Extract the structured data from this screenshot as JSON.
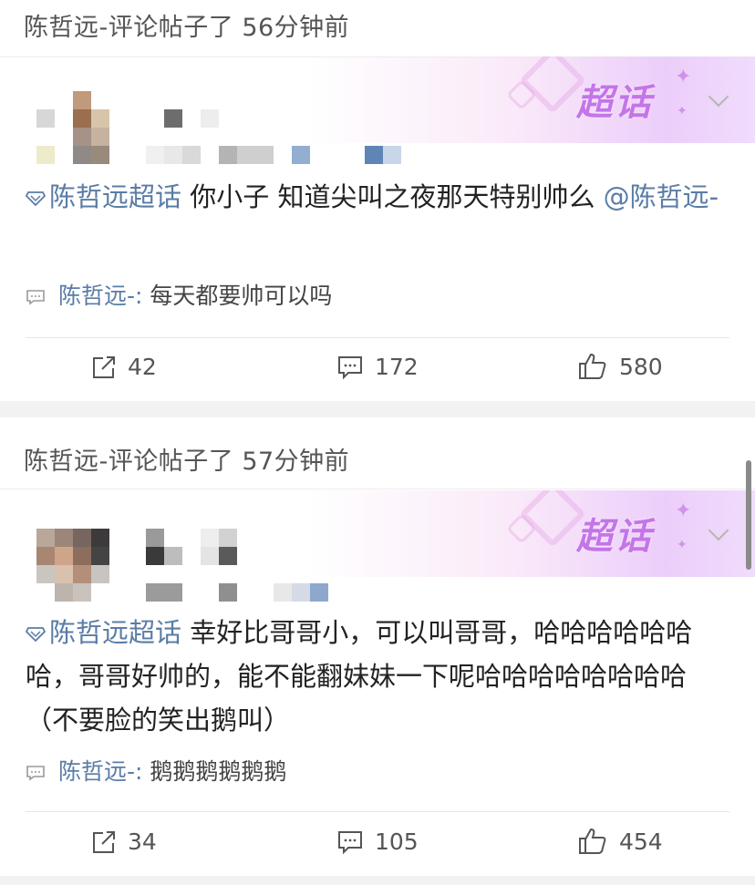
{
  "posts": [
    {
      "header": "陈哲远-评论帖子了 56分钟前",
      "badge": "超话",
      "topic": "陈哲远超话",
      "body": " 你小子 知道尖叫之夜那天特别帅么 ",
      "mention": "@陈哲远-",
      "comment_user": "陈哲远-:",
      "comment_text": " 每天都要帅可以吗",
      "reposts": "42",
      "comments": "172",
      "likes": "580"
    },
    {
      "header": "陈哲远-评论帖子了 57分钟前",
      "badge": "超话",
      "topic": "陈哲远超话",
      "body": " 幸好比哥哥小，可以叫哥哥，哈哈哈哈哈哈哈，哥哥好帅的，能不能翻妹妹一下呢哈哈哈哈哈哈哈哈（不要脸的笑出鹅叫）",
      "mention": "",
      "comment_user": "陈哲远-:",
      "comment_text": " 鹅鹅鹅鹅鹅鹅",
      "reposts": "34",
      "comments": "105",
      "likes": "454"
    }
  ],
  "icons": {
    "topic": "diamond-topic-icon",
    "comment_bubble": "comment-bubble-icon",
    "repost": "repost-icon",
    "comment": "comment-icon",
    "like": "like-icon",
    "expand": "chevron-down-icon"
  },
  "colors": {
    "link": "#5a7ca6",
    "badge": "#c475e8",
    "divider": "#e6e6e6",
    "band": "#f2f2f2"
  }
}
